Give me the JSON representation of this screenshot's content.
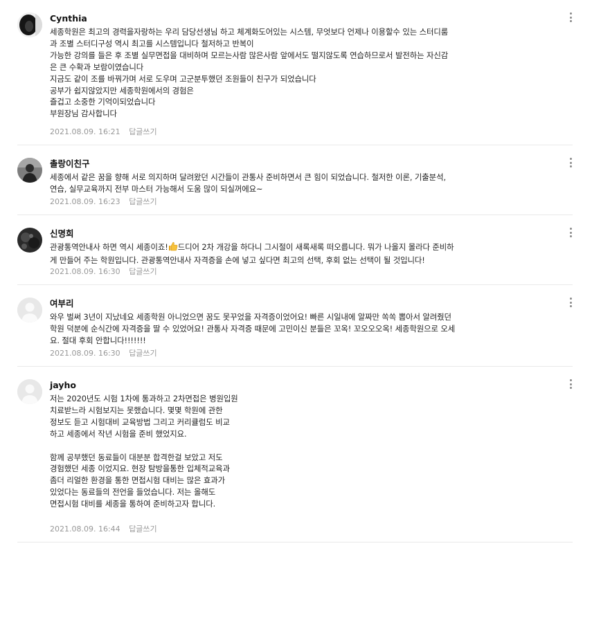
{
  "reply_label": "답글쓰기",
  "comments": [
    {
      "author": "Cynthia",
      "avatar": "dark-profile-photo",
      "text": "세종학원은 최고의 경력을자랑하는 우리 담당선생님 하고 체계화도어있는 시스템, 무엇보다 언제나 이용할수 있는 스터디룸\n과 조별 스터디구성 역시 최고를 시스템입니다 철저하고 반복이\n가능한 강의를 들은 후 조별 실무면접을 대비하며 모르는사람 많은사람 앞에서도 떨지않도록 연습하므로서 발전하는 자신감\n은 큰 수확과 보람이였습니다\n지금도 같이 조를 바꿔가며 서로 도우며 고군분투했던 조원들이 친구가 되었습니다\n공부가 쉽지않았지만 세종학원에서의 경험은\n즐겁고 소중한 기억이되었습니다\n부원장님 감사합니다",
      "date": "2021.08.09. 16:21"
    },
    {
      "author": "촐랑이친구",
      "avatar": "person-profile-photo",
      "text": "세종에서 같은 꿈을 향해 서로 의지하며 달려왔던 시간들이 관통사 준비하면서 큰 힘이 되었습니다. 철저한 이론, 기출분석,\n연습, 실무교육까지 전부 마스터 가능해서 도움 많이 되실꺼에요~",
      "date": "2021.08.09. 16:23"
    },
    {
      "author": "신명희",
      "avatar": "dark-profile-photo-2",
      "text_before_emoji": "관광통역안내사 하면 역시 세종이죠!",
      "emoji": "thumbs-up-emoji",
      "text_after_emoji": "드디어 2차 개강을 하다니 그시절이 새록새록 떠오릅니다. 뭐가 나올지 몰라다 준비하\n게 만들어 주는 학원입니다. 관광통역안내사 자격증을 손에 넣고 싶다면 최고의 선택, 후회 없는 선택이 될 것입니다!",
      "date": "2021.08.09. 16:30"
    },
    {
      "author": "여부리",
      "avatar": "default-avatar",
      "text": "와우 벌써 3년이 지났네요 세종학원 아니었으면 꿈도 못꾸었을 자격증이었어요! 빠른 시일내에 알짜만 쏙쏙 뽑아서 알려줬던\n학원 덕분에 순식간에 자격증을 딸 수 있었어요! 관통사 자격증 때문에 고민이신 분들은 꼬옥! 꼬오오오옥! 세종학원으로 오세\n요. 절대 후회 안합니다!!!!!!!",
      "date": "2021.08.09. 16:30"
    },
    {
      "author": "jayho",
      "avatar": "default-avatar",
      "text": "저는 2020년도 시험 1차에 통과하고 2차면접은 병원입원\n치료받느라 시험보지는 못했습니다. 몇몇 학원에 관한\n정보도 듣고 시험대비 교육방법 그리고 커리큘럼도 비교\n하고 세종에서 작년 시험을 준비 했었지요.\n\n함께 공부했던 동료들이 대분분 합격한걸 보았고 저도\n경험했던 세종 이었지요. 현장 탐방을통한 입체적교육과\n좀더 리얼한 환경을 통한 면접시험 대비는 많은 효과가\n있었다는 동료들의 전언을 들었습니다. 저는 올해도\n면접시험 대비를 세종을 통하여 준비하고자 합니다.",
      "date": "2021.08.09. 16:44"
    }
  ]
}
